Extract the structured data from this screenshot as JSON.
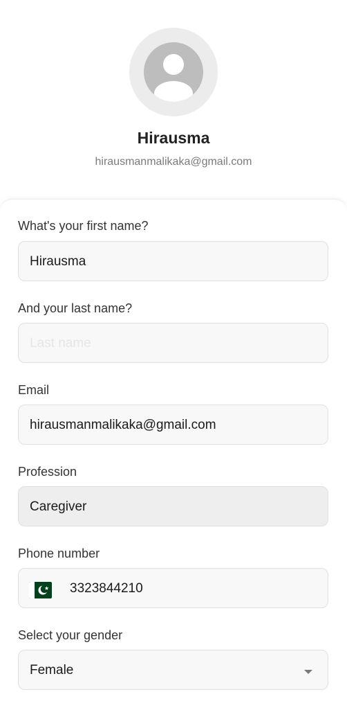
{
  "profile": {
    "name": "Hirausma",
    "email": "hirausmanmalikaka@gmail.com"
  },
  "form": {
    "first_name": {
      "label": "What's your first name?",
      "value": "Hirausma"
    },
    "last_name": {
      "label": "And your last name?",
      "value": "",
      "placeholder": "Last name"
    },
    "email": {
      "label": "Email",
      "value": "hirausmanmalikaka@gmail.com"
    },
    "profession": {
      "label": "Profession",
      "value": "Caregiver"
    },
    "phone": {
      "label": "Phone number",
      "country_icon": "pakistan-flag-icon",
      "value": "3323844210"
    },
    "gender": {
      "label": "Select your gender",
      "value": "Female"
    }
  },
  "colors": {
    "field_background": "#f8f8f8",
    "field_border": "#e0e0e0",
    "disabled_background": "#eeeeee",
    "flag_green": "#01411c"
  }
}
